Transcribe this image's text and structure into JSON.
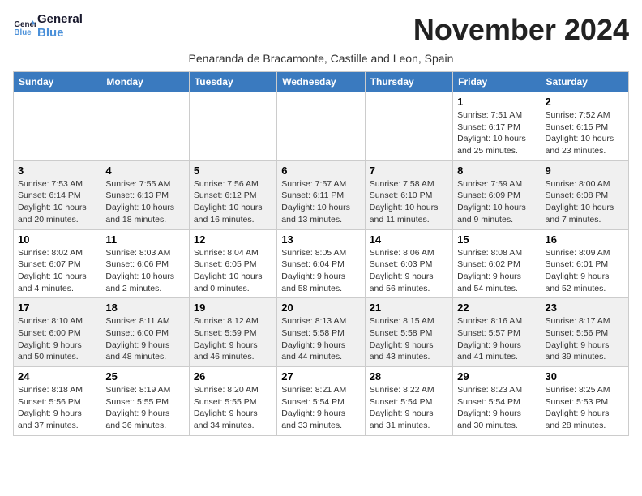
{
  "header": {
    "logo_line1": "General",
    "logo_line2": "Blue",
    "month_title": "November 2024",
    "subtitle": "Penaranda de Bracamonte, Castille and Leon, Spain"
  },
  "weekdays": [
    "Sunday",
    "Monday",
    "Tuesday",
    "Wednesday",
    "Thursday",
    "Friday",
    "Saturday"
  ],
  "weeks": [
    [
      {
        "day": "",
        "info": ""
      },
      {
        "day": "",
        "info": ""
      },
      {
        "day": "",
        "info": ""
      },
      {
        "day": "",
        "info": ""
      },
      {
        "day": "",
        "info": ""
      },
      {
        "day": "1",
        "info": "Sunrise: 7:51 AM\nSunset: 6:17 PM\nDaylight: 10 hours and 25 minutes."
      },
      {
        "day": "2",
        "info": "Sunrise: 7:52 AM\nSunset: 6:15 PM\nDaylight: 10 hours and 23 minutes."
      }
    ],
    [
      {
        "day": "3",
        "info": "Sunrise: 7:53 AM\nSunset: 6:14 PM\nDaylight: 10 hours and 20 minutes."
      },
      {
        "day": "4",
        "info": "Sunrise: 7:55 AM\nSunset: 6:13 PM\nDaylight: 10 hours and 18 minutes."
      },
      {
        "day": "5",
        "info": "Sunrise: 7:56 AM\nSunset: 6:12 PM\nDaylight: 10 hours and 16 minutes."
      },
      {
        "day": "6",
        "info": "Sunrise: 7:57 AM\nSunset: 6:11 PM\nDaylight: 10 hours and 13 minutes."
      },
      {
        "day": "7",
        "info": "Sunrise: 7:58 AM\nSunset: 6:10 PM\nDaylight: 10 hours and 11 minutes."
      },
      {
        "day": "8",
        "info": "Sunrise: 7:59 AM\nSunset: 6:09 PM\nDaylight: 10 hours and 9 minutes."
      },
      {
        "day": "9",
        "info": "Sunrise: 8:00 AM\nSunset: 6:08 PM\nDaylight: 10 hours and 7 minutes."
      }
    ],
    [
      {
        "day": "10",
        "info": "Sunrise: 8:02 AM\nSunset: 6:07 PM\nDaylight: 10 hours and 4 minutes."
      },
      {
        "day": "11",
        "info": "Sunrise: 8:03 AM\nSunset: 6:06 PM\nDaylight: 10 hours and 2 minutes."
      },
      {
        "day": "12",
        "info": "Sunrise: 8:04 AM\nSunset: 6:05 PM\nDaylight: 10 hours and 0 minutes."
      },
      {
        "day": "13",
        "info": "Sunrise: 8:05 AM\nSunset: 6:04 PM\nDaylight: 9 hours and 58 minutes."
      },
      {
        "day": "14",
        "info": "Sunrise: 8:06 AM\nSunset: 6:03 PM\nDaylight: 9 hours and 56 minutes."
      },
      {
        "day": "15",
        "info": "Sunrise: 8:08 AM\nSunset: 6:02 PM\nDaylight: 9 hours and 54 minutes."
      },
      {
        "day": "16",
        "info": "Sunrise: 8:09 AM\nSunset: 6:01 PM\nDaylight: 9 hours and 52 minutes."
      }
    ],
    [
      {
        "day": "17",
        "info": "Sunrise: 8:10 AM\nSunset: 6:00 PM\nDaylight: 9 hours and 50 minutes."
      },
      {
        "day": "18",
        "info": "Sunrise: 8:11 AM\nSunset: 6:00 PM\nDaylight: 9 hours and 48 minutes."
      },
      {
        "day": "19",
        "info": "Sunrise: 8:12 AM\nSunset: 5:59 PM\nDaylight: 9 hours and 46 minutes."
      },
      {
        "day": "20",
        "info": "Sunrise: 8:13 AM\nSunset: 5:58 PM\nDaylight: 9 hours and 44 minutes."
      },
      {
        "day": "21",
        "info": "Sunrise: 8:15 AM\nSunset: 5:58 PM\nDaylight: 9 hours and 43 minutes."
      },
      {
        "day": "22",
        "info": "Sunrise: 8:16 AM\nSunset: 5:57 PM\nDaylight: 9 hours and 41 minutes."
      },
      {
        "day": "23",
        "info": "Sunrise: 8:17 AM\nSunset: 5:56 PM\nDaylight: 9 hours and 39 minutes."
      }
    ],
    [
      {
        "day": "24",
        "info": "Sunrise: 8:18 AM\nSunset: 5:56 PM\nDaylight: 9 hours and 37 minutes."
      },
      {
        "day": "25",
        "info": "Sunrise: 8:19 AM\nSunset: 5:55 PM\nDaylight: 9 hours and 36 minutes."
      },
      {
        "day": "26",
        "info": "Sunrise: 8:20 AM\nSunset: 5:55 PM\nDaylight: 9 hours and 34 minutes."
      },
      {
        "day": "27",
        "info": "Sunrise: 8:21 AM\nSunset: 5:54 PM\nDaylight: 9 hours and 33 minutes."
      },
      {
        "day": "28",
        "info": "Sunrise: 8:22 AM\nSunset: 5:54 PM\nDaylight: 9 hours and 31 minutes."
      },
      {
        "day": "29",
        "info": "Sunrise: 8:23 AM\nSunset: 5:54 PM\nDaylight: 9 hours and 30 minutes."
      },
      {
        "day": "30",
        "info": "Sunrise: 8:25 AM\nSunset: 5:53 PM\nDaylight: 9 hours and 28 minutes."
      }
    ]
  ]
}
